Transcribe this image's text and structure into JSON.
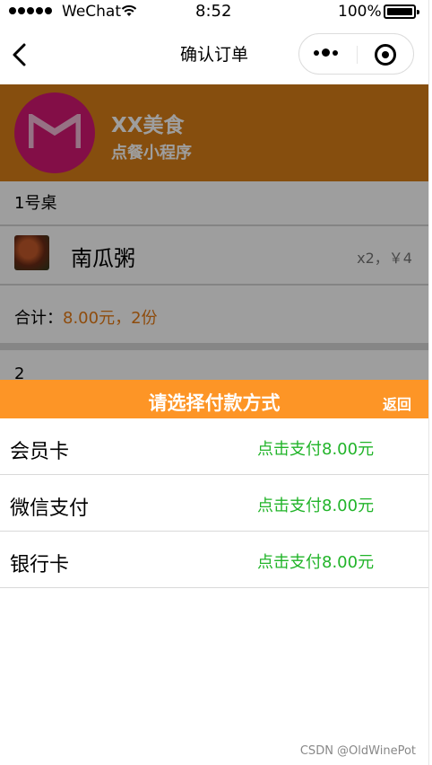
{
  "status_bar": {
    "carrier": "WeChat",
    "time": "8:52",
    "battery": "100%"
  },
  "nav": {
    "title": "确认订单"
  },
  "brand": {
    "name": "XX美食",
    "subtitle": "点餐小程序"
  },
  "order": {
    "table": "1号桌",
    "item": {
      "name": "南瓜粥",
      "qty_price": "x2，￥4"
    },
    "total_label": "合计：",
    "total_value": "8.00元，2份",
    "next_fragment": "2"
  },
  "payment": {
    "title": "请选择付款方式",
    "back_label": "返回",
    "options": [
      {
        "name": "会员卡",
        "action": "点击支付8.00元"
      },
      {
        "name": "微信支付",
        "action": "点击支付8.00元"
      },
      {
        "name": "银行卡",
        "action": "点击支付8.00元"
      }
    ]
  },
  "watermark": "CSDN @OldWinePot",
  "colors": {
    "brand": "#d97e17",
    "logo": "#d31873",
    "sheet_header": "#fd9526",
    "pay_action": "#21b429",
    "total_value": "#e67b16"
  },
  "icons": [
    "signal-icon",
    "wifi-icon",
    "battery-icon",
    "back-arrow-icon",
    "more-icon",
    "target-icon",
    "logo-icon"
  ]
}
